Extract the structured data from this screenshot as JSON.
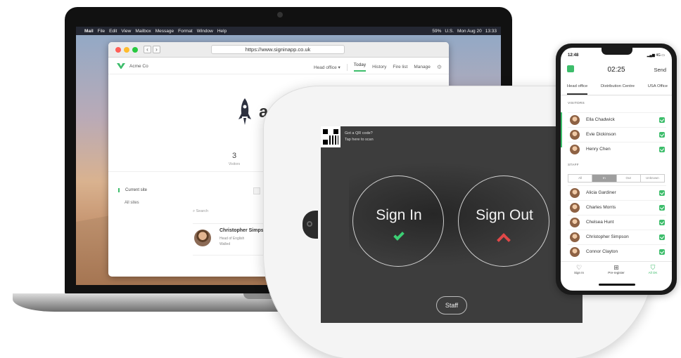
{
  "macos": {
    "menu": [
      "Mail",
      "File",
      "Edit",
      "View",
      "Mailbox",
      "Message",
      "Format",
      "Window",
      "Help"
    ],
    "status": [
      "59%",
      "U.S.",
      "Mon Aug 20",
      "13:33"
    ]
  },
  "browser": {
    "url": "https://www.signinapp.co.uk",
    "brand": "Acme Co",
    "site_select": "Head office",
    "nav": [
      "Today",
      "History",
      "Fire list",
      "Manage"
    ],
    "logo_text": "acme",
    "stat_value": "3",
    "stat_label": "Visitors",
    "sidebar": [
      "Current site",
      "All sites"
    ],
    "search_placeholder": "Search",
    "person": {
      "name": "Christopher Simpson",
      "role": "Head of English",
      "status": "Walled"
    }
  },
  "tablet": {
    "qr_line1": "Got a QR code?",
    "qr_line2": "Tap here to scan",
    "sign_in": "Sign In",
    "sign_out": "Sign Out",
    "staff": "Staff"
  },
  "phone": {
    "status_time": "12:48",
    "status_right": "4G",
    "clock": "02:25",
    "send": "Send",
    "tabs": [
      "Head office",
      "Distribution Centre",
      "USA Office"
    ],
    "visitors_label": "VISITORS",
    "visitors": [
      "Ella Chadwick",
      "Evie Dickinson",
      "Henry Chen"
    ],
    "staff_label": "STAFF",
    "segments": [
      "All",
      "In",
      "Out",
      "Unknown"
    ],
    "staff": [
      "Alicia Gardiner",
      "Charles Morris",
      "Chelsea Hunt",
      "Christopher Simpson",
      "Connor Clayton"
    ],
    "bottom_nav": [
      "Sign In",
      "Pre-register",
      "All OK"
    ],
    "accent": "#3dbd6b"
  }
}
